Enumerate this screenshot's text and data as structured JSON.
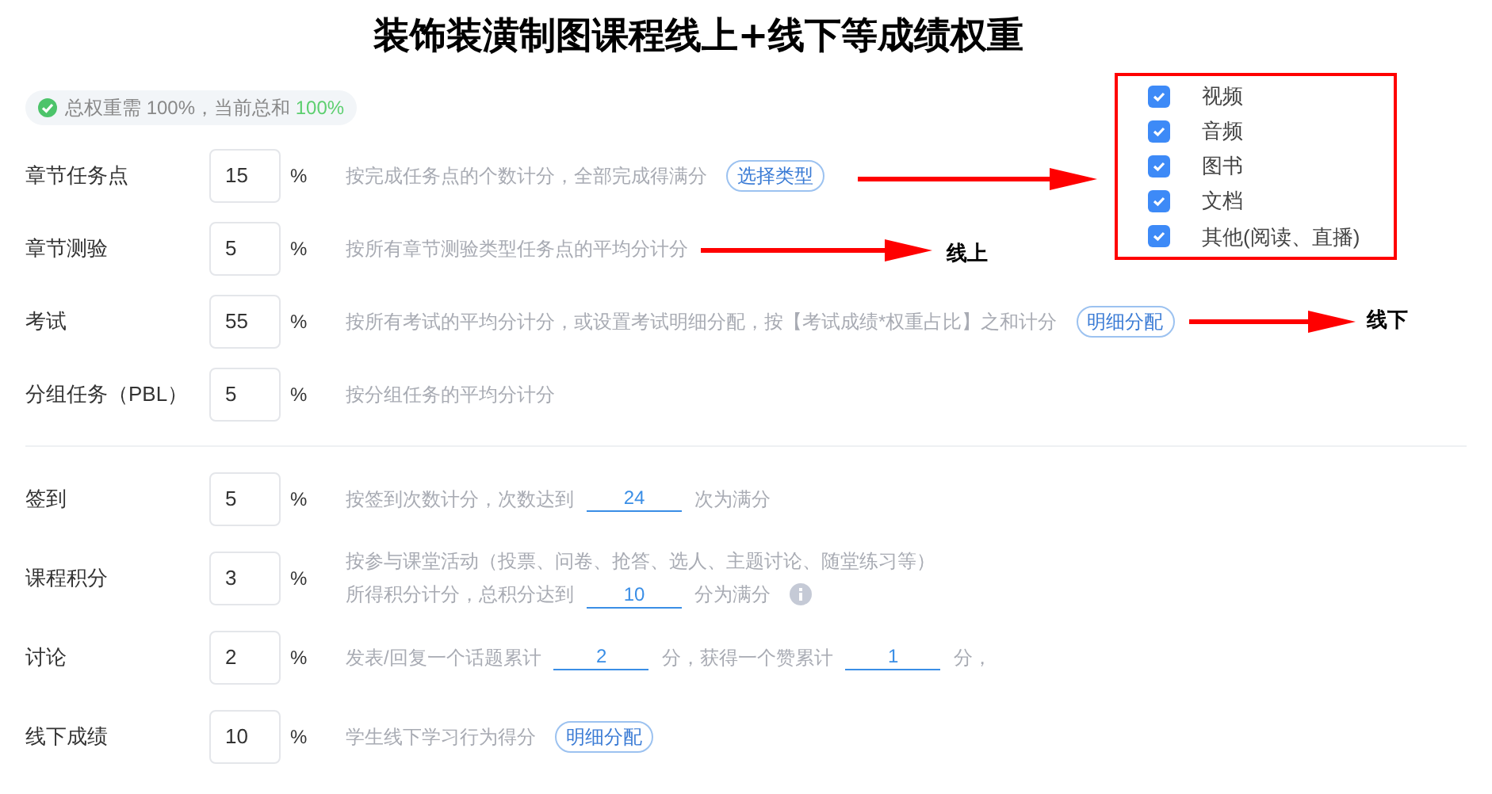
{
  "title": "装饰装潢制图课程线上+线下等成绩权重",
  "summary": {
    "text": "总权重需 100%，当前总和 ",
    "total": "100%",
    "ok": true
  },
  "groups": [
    {
      "rows": [
        {
          "label": "章节任务点",
          "value": "15",
          "unit": "%",
          "lines": [
            [
              {
                "kind": "text",
                "text": "按完成任务点的个数计分，全部完成得满分"
              },
              {
                "kind": "button",
                "text": "选择类型"
              }
            ]
          ]
        },
        {
          "label": "章节测验",
          "value": "5",
          "unit": "%",
          "lines": [
            [
              {
                "kind": "text",
                "text": "按所有章节测验类型任务点的平均分计分"
              }
            ]
          ]
        },
        {
          "label": "考试",
          "value": "55",
          "unit": "%",
          "lines": [
            [
              {
                "kind": "text",
                "text": "按所有考试的平均分计分，或设置考试明细分配，按【考试成绩*权重占比】之和计分"
              },
              {
                "kind": "button",
                "text": "明细分配"
              }
            ]
          ]
        },
        {
          "label": "分组任务（PBL）",
          "value": "5",
          "unit": "%",
          "lines": [
            [
              {
                "kind": "text",
                "text": "按分组任务的平均分计分"
              }
            ]
          ]
        }
      ]
    },
    {
      "rows": [
        {
          "label": "签到",
          "value": "5",
          "unit": "%",
          "lines": [
            [
              {
                "kind": "text",
                "text": "按签到次数计分，次数达到"
              },
              {
                "kind": "field",
                "text": "24"
              },
              {
                "kind": "text",
                "text": "次为满分"
              }
            ]
          ]
        },
        {
          "label": "课程积分",
          "value": "3",
          "unit": "%",
          "lines": [
            [
              {
                "kind": "text",
                "text": "按参与课堂活动（投票、问卷、抢答、选人、主题讨论、随堂练习等）"
              }
            ],
            [
              {
                "kind": "text",
                "text": "所得积分计分，总积分达到"
              },
              {
                "kind": "field",
                "text": "10"
              },
              {
                "kind": "text",
                "text": "分为满分"
              },
              {
                "kind": "info"
              }
            ]
          ]
        },
        {
          "label": "讨论",
          "value": "2",
          "unit": "%",
          "lines": [
            [
              {
                "kind": "text",
                "text": "发表/回复一个话题累计"
              },
              {
                "kind": "field",
                "text": "2"
              },
              {
                "kind": "text",
                "text": "分，获得一个赞累计"
              },
              {
                "kind": "field",
                "text": "1"
              },
              {
                "kind": "text",
                "text": "分，"
              }
            ]
          ]
        },
        {
          "label": "线下成绩",
          "value": "10",
          "unit": "%",
          "lines": [
            [
              {
                "kind": "text",
                "text": "学生线下学习行为得分"
              },
              {
                "kind": "button",
                "text": "明细分配"
              }
            ]
          ]
        }
      ]
    }
  ],
  "type_panel": {
    "items": [
      {
        "label": "视频",
        "checked": true
      },
      {
        "label": "音频",
        "checked": true
      },
      {
        "label": "图书",
        "checked": true
      },
      {
        "label": "文档",
        "checked": true
      },
      {
        "label": "其他(阅读、直播)",
        "checked": true
      }
    ]
  },
  "annotations": [
    {
      "label": "线上"
    },
    {
      "label": "线下"
    }
  ]
}
